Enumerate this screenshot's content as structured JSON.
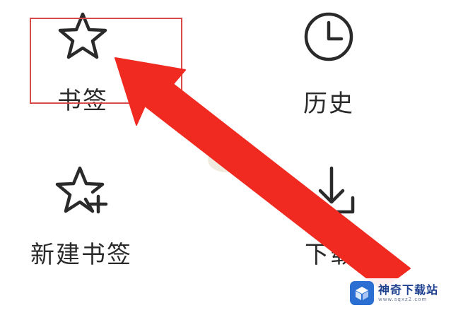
{
  "menu": {
    "items": [
      {
        "label": "书签",
        "icon": "star-icon"
      },
      {
        "label": "历史",
        "icon": "clock-icon"
      },
      {
        "label": "新建书签",
        "icon": "star-plus-icon"
      },
      {
        "label": "下载",
        "icon": "download-icon"
      }
    ]
  },
  "annotation": {
    "highlight_color": "#d94a4a",
    "arrow_color": "#f02a20"
  },
  "watermark": {
    "name": "神奇下载站",
    "site": "www.sqxz2.com"
  }
}
